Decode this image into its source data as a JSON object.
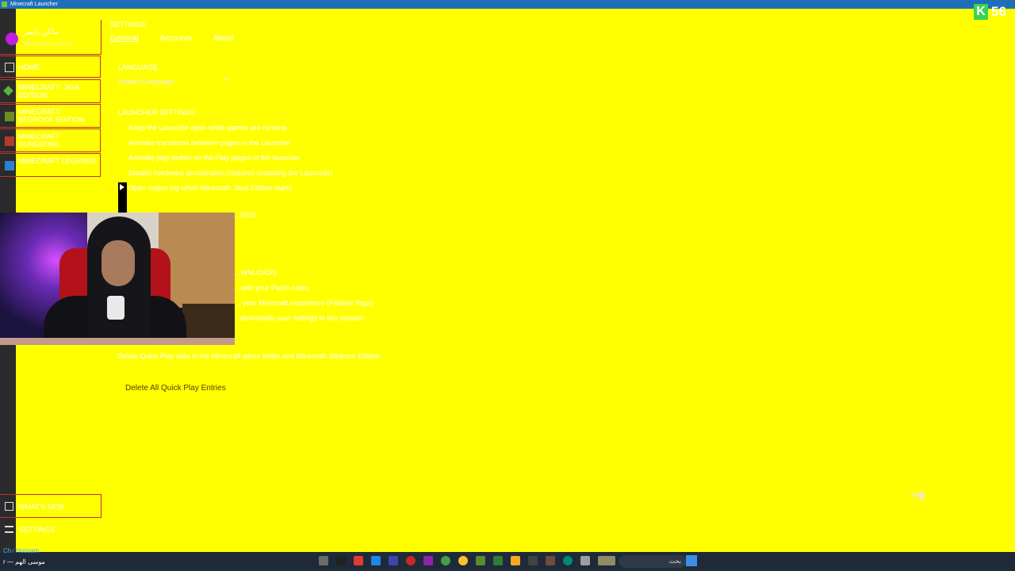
{
  "window": {
    "title": "Minecraft Launcher"
  },
  "account": {
    "name": "ماكن تايمز",
    "sub": "Microsoft account"
  },
  "sidebar": {
    "items": [
      {
        "label": "HOME"
      },
      {
        "label": "MINECRAFT: JAVA EDITION"
      },
      {
        "label": "MINECRAFT: BEDROCK EDITION"
      },
      {
        "label": "MINECRAFT DUNGEONS"
      },
      {
        "label": "MINECRAFT LEGENDS"
      }
    ],
    "whats_new": "WHAT'S NEW",
    "settings": "SETTINGS"
  },
  "main": {
    "page_title": "SETTINGS",
    "tabs": [
      {
        "label": "General"
      },
      {
        "label": "Accounts"
      },
      {
        "label": "About"
      }
    ],
    "language_label": "LANGUAGE",
    "language_value": "Default Language",
    "launcher_settings_label": "LAUNCHER SETTINGS",
    "launcher_options": [
      "Keep the Launcher open while games are running",
      "Animate transitions between pages in the Launcher",
      "Animate play button on the Play pages of the launcher",
      "Disable hardware acceleration (requires restarting the Launcher)",
      "Open output log when Minecraft: Java Edition starts"
    ],
    "webcam_captions": [
      "...NGS",
      "...WNLOADS",
      "...with your Patch notes",
      "... your Minecraft experience (Feature flags)",
      "...downloads your settings in this session"
    ],
    "quick_play_option": "Delete Quick Play data in the Minecraft game folder and Minecraft: Bedrock Edition",
    "delete_button": "Delete All Quick Play Entries"
  },
  "badge": {
    "letter": "K",
    "count": "56"
  },
  "taskbar": {
    "line1": "Ch ⁄ Hossam",
    "line2": "r — موسى الهم",
    "search": "بحث"
  },
  "colors": {
    "background": "#ffff00",
    "titlebar": "#1e6fb8",
    "taskbar": "#1f2a38"
  }
}
